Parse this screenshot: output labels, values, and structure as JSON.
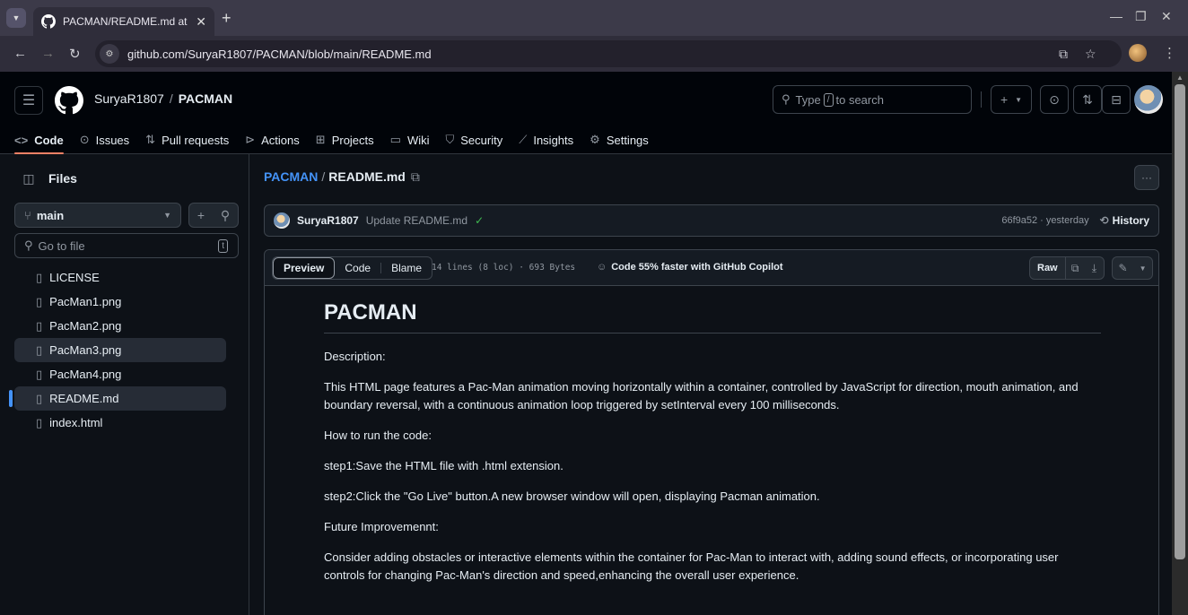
{
  "browser": {
    "tab_title": "PACMAN/README.md at main",
    "url": "github.com/SuryaR1807/PACMAN/blob/main/README.md"
  },
  "header": {
    "owner": "SuryaR1807",
    "separator": "/",
    "repo": "PACMAN",
    "search_prefix": "Type",
    "search_key": "/",
    "search_suffix": "to search"
  },
  "repo_nav": [
    {
      "label": "Code",
      "icon": "code-icon"
    },
    {
      "label": "Issues",
      "icon": "issue-icon"
    },
    {
      "label": "Pull requests",
      "icon": "pull-request-icon"
    },
    {
      "label": "Actions",
      "icon": "play-icon"
    },
    {
      "label": "Projects",
      "icon": "table-icon"
    },
    {
      "label": "Wiki",
      "icon": "book-icon"
    },
    {
      "label": "Security",
      "icon": "shield-icon"
    },
    {
      "label": "Insights",
      "icon": "graph-icon"
    },
    {
      "label": "Settings",
      "icon": "gear-icon"
    }
  ],
  "sidebar": {
    "title": "Files",
    "branch": "main",
    "goto_placeholder": "Go to file",
    "goto_key": "t",
    "files": [
      "LICENSE",
      "PacMan1.png",
      "PacMan2.png",
      "PacMan3.png",
      "PacMan4.png",
      "README.md",
      "index.html"
    ]
  },
  "breadcrumb": {
    "repo": "PACMAN",
    "separator": "/",
    "file": "README.md"
  },
  "commit": {
    "author": "SuryaR1807",
    "message": "Update README.md",
    "meta": "66f9a52 · yesterday",
    "history_label": "History"
  },
  "file_header": {
    "tabs": [
      "Preview",
      "Code",
      "Blame"
    ],
    "stats": "14 lines (8 loc) · 693 Bytes",
    "copilot": "Code 55% faster with GitHub Copilot",
    "raw_label": "Raw"
  },
  "readme": {
    "title": "PACMAN",
    "paragraphs": [
      "Description:",
      "This HTML page features a Pac-Man animation moving horizontally within a container, controlled by JavaScript for direction, mouth animation, and boundary reversal, with a continuous animation loop triggered by setInterval every 100 milliseconds.",
      "How to run the code:",
      "step1:Save the HTML file with .html extension.",
      "step2:Click the \"Go Live\" button.A new browser window will open, displaying Pacman animation.",
      "Future Improvemennt:",
      "Consider adding obstacles or interactive elements within the container for Pac-Man to interact with, adding sound effects, or incorporating user controls for changing Pac-Man's direction and speed,enhancing the overall user experience."
    ]
  }
}
